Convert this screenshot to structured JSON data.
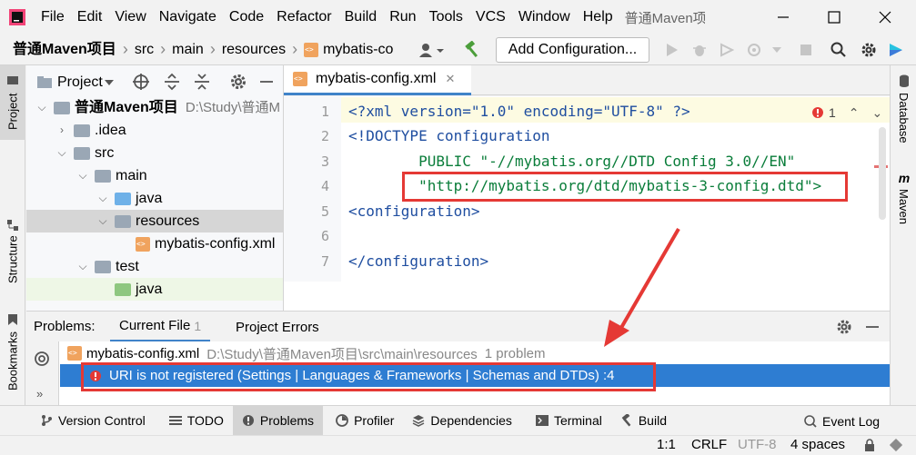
{
  "menu": {
    "items": [
      "File",
      "Edit",
      "View",
      "Navigate",
      "Code",
      "Refactor",
      "Build",
      "Run",
      "Tools",
      "VCS",
      "Window",
      "Help"
    ],
    "project_title": "普通Maven项目"
  },
  "navbar": {
    "crumbs": [
      "普通Maven项目",
      "src",
      "main",
      "resources",
      "mybatis-cor"
    ],
    "add_config": "Add Configuration..."
  },
  "left_stripe": {
    "project": "Project",
    "structure": "Structure",
    "bookmarks": "Bookmarks"
  },
  "right_stripe": {
    "database": "Database",
    "maven": "Maven"
  },
  "project_panel": {
    "title": "Project",
    "tree": [
      {
        "label": "普通Maven项目",
        "path": "D:\\Study\\普通M"
      },
      {
        "label": ".idea"
      },
      {
        "label": "src"
      },
      {
        "label": "main"
      },
      {
        "label": "java"
      },
      {
        "label": "resources"
      },
      {
        "label": "mybatis-config.xml"
      },
      {
        "label": "test"
      },
      {
        "label": "java"
      }
    ]
  },
  "editor": {
    "tab": "mybatis-config.xml",
    "error_count": "1",
    "line_numbers": [
      "1",
      "2",
      "3",
      "4",
      "5",
      "6",
      "7"
    ],
    "lines": [
      "<?xml version=\"1.0\" encoding=\"UTF-8\" ?>",
      "<!DOCTYPE configuration",
      "        PUBLIC \"-//mybatis.org//DTD Config 3.0//EN\"",
      "        \"http://mybatis.org/dtd/mybatis-3-config.dtd\">",
      "<configuration>",
      "",
      "</configuration>"
    ]
  },
  "problems": {
    "label": "Problems:",
    "tabs": [
      {
        "label": "Current File",
        "count": "1"
      },
      {
        "label": "Project Errors"
      }
    ],
    "file": "mybatis-config.xml",
    "file_path": "D:\\Study\\普通Maven项目\\src\\main\\resources",
    "file_count": "1 problem",
    "message": "URI is not registered (Settings | Languages & Frameworks | Schemas and DTDs) :4"
  },
  "bottom_tabs": [
    "Version Control",
    "TODO",
    "Problems",
    "Profiler",
    "Dependencies",
    "Terminal",
    "Build"
  ],
  "event_log": "Event Log",
  "status": {
    "position": "1:1",
    "line_sep": "CRLF",
    "encoding": "UTF-8",
    "indent": "4 spaces"
  },
  "colors": {
    "accent": "#2e7dd2",
    "error": "#e53935",
    "keyword": "#1f4ea0",
    "string": "#0a7d3a",
    "annot_red": "#e53935"
  }
}
